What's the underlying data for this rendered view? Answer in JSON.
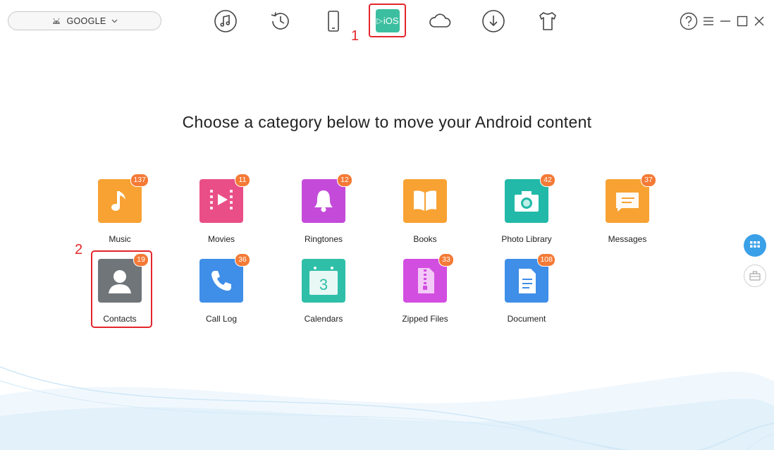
{
  "device": {
    "name": "GOOGLE"
  },
  "toolbar": {
    "ios_label": "iOS",
    "step1": "1"
  },
  "headline": "Choose a category below to move your Android content",
  "step2": "2",
  "categories": [
    {
      "label": "Music",
      "count": "137",
      "color": "#f7a233"
    },
    {
      "label": "Movies",
      "count": "11",
      "color": "#e94f86"
    },
    {
      "label": "Ringtones",
      "count": "12",
      "color": "#c44bd9"
    },
    {
      "label": "Books",
      "count": "",
      "color": "#f7a233"
    },
    {
      "label": "Photo Library",
      "count": "42",
      "color": "#22b9a8"
    },
    {
      "label": "Messages",
      "count": "37",
      "color": "#f7a233"
    },
    {
      "label": "Contacts",
      "count": "19",
      "color": "#6f7579"
    },
    {
      "label": "Call Log",
      "count": "36",
      "color": "#3f8ee8"
    },
    {
      "label": "Calendars",
      "count": "",
      "color": "#2fbfa8"
    },
    {
      "label": "Zipped Files",
      "count": "33",
      "color": "#d24ee0"
    },
    {
      "label": "Document",
      "count": "108",
      "color": "#3f8ee8"
    }
  ],
  "colors": {
    "accent_red": "#e3262b",
    "badge": "#f47a36",
    "side_active": "#3aa0e8"
  }
}
